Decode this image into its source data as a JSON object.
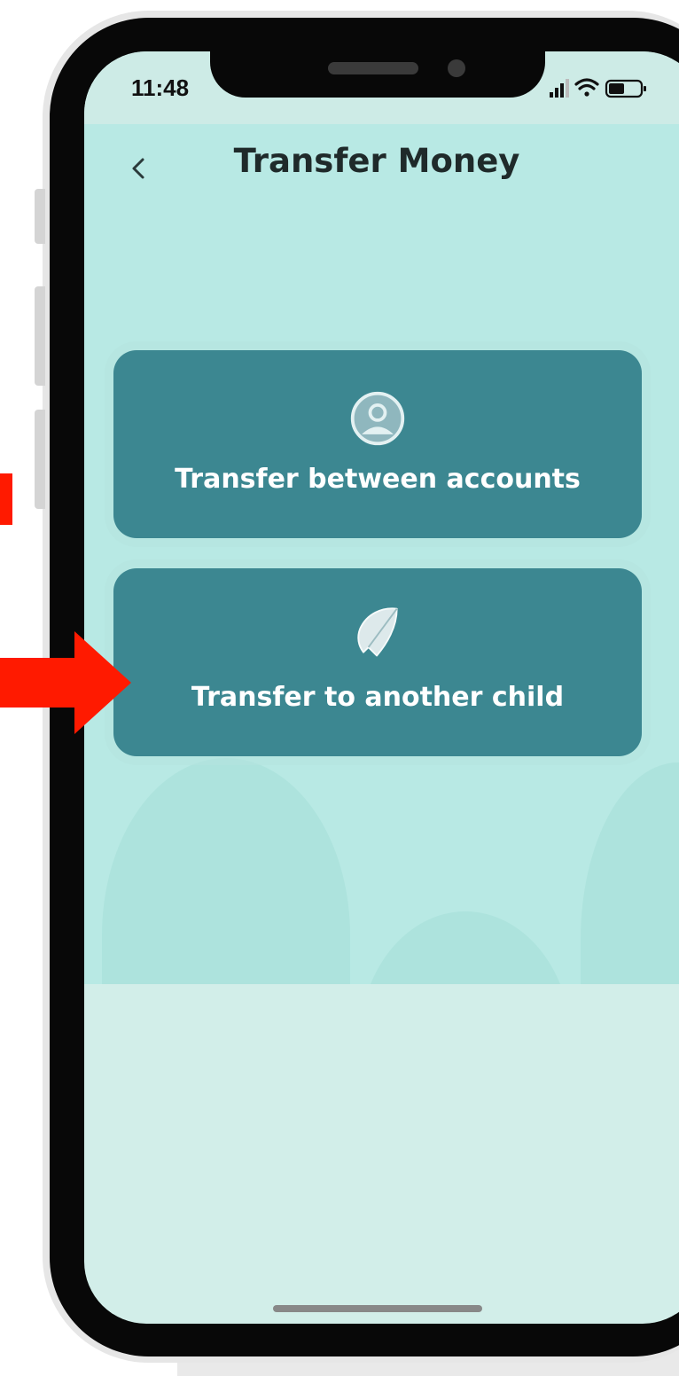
{
  "status_bar": {
    "time": "11:48",
    "icons": [
      "signal-icon",
      "wifi-icon",
      "battery-icon"
    ]
  },
  "header": {
    "back_icon": "chevron-left-icon",
    "title": "Transfer Money"
  },
  "options": [
    {
      "label": "Transfer between accounts",
      "icon": "user-circle-icon"
    },
    {
      "label": "Transfer to another child",
      "icon": "paper-plane-icon"
    }
  ],
  "annotation": {
    "arrow_icon": "arrow-right-icon",
    "color": "#ff1a00"
  },
  "colors": {
    "card": "#3c8791",
    "background": "#b8e9e4",
    "lower_background": "#d2eee9",
    "title": "#1f2a2a"
  }
}
